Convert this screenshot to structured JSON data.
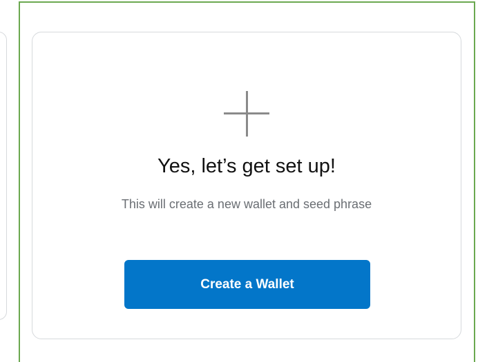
{
  "card": {
    "icon": "plus-icon",
    "title": "Yes, let’s get set up!",
    "description": "This will create a new wallet and seed phrase",
    "button_label": "Create a Wallet"
  },
  "colors": {
    "selection_frame": "#6aa84f",
    "button_background": "#0376c9",
    "button_text": "#ffffff",
    "icon": "#8a8a8a",
    "title_text": "#111111",
    "description_text": "#6a6e73",
    "card_border": "#d6d9dc"
  }
}
